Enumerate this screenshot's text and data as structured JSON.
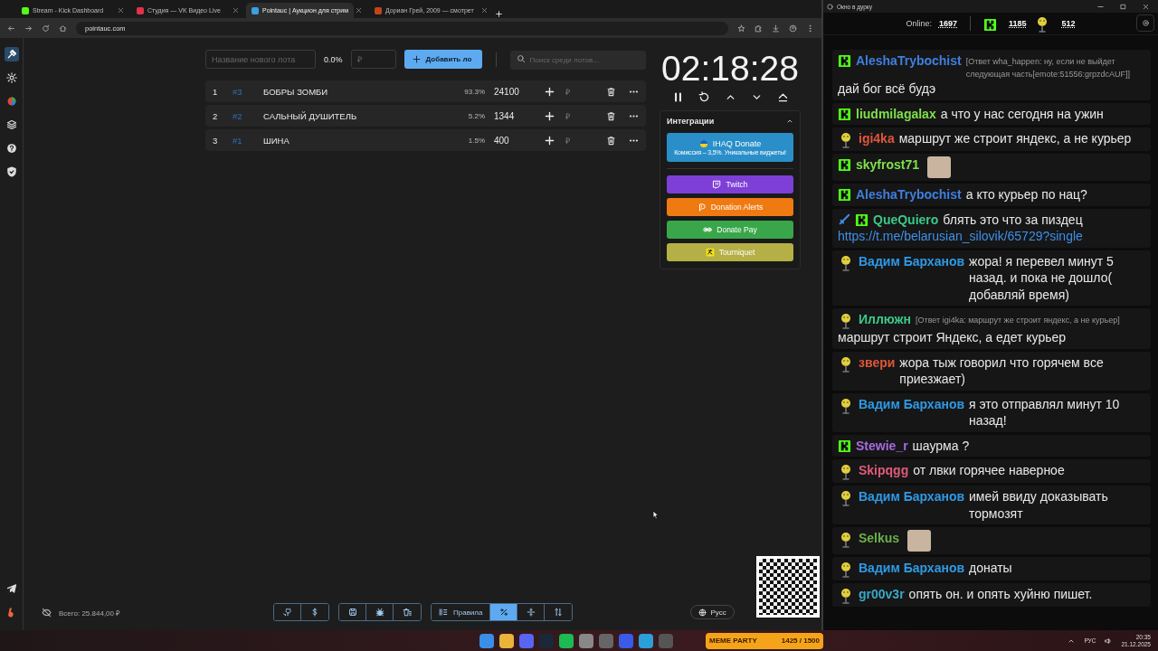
{
  "browser": {
    "tabs": [
      {
        "title": "Stream - Kick Dashboard",
        "selected": false
      },
      {
        "title": "Студия — VK Видео Live",
        "selected": false
      },
      {
        "title": "Pointauc | Аукцион для стрим",
        "selected": true
      },
      {
        "title": "Дориан Грей, 2009 — смотрет",
        "selected": false
      }
    ],
    "url": "pointauc.com"
  },
  "sidebar": {
    "items": [
      {
        "kind": "hammer",
        "selected": true
      },
      {
        "kind": "gear",
        "selected": false
      },
      {
        "kind": "wheel",
        "selected": false
      },
      {
        "kind": "layers",
        "selected": false
      },
      {
        "kind": "help",
        "selected": false
      },
      {
        "kind": "shield",
        "selected": false
      }
    ],
    "bottom_items": [
      {
        "kind": "telegram"
      },
      {
        "kind": "boosty"
      }
    ]
  },
  "auction": {
    "name_placeholder": "Название нового лота",
    "percent": "0.0%",
    "price_placeholder": "₽",
    "add_button": "Добавить ло",
    "search_placeholder": "Поиск среди лотов...",
    "lots": [
      {
        "place": "1",
        "id": "#3",
        "name": "БОБРЫ ЗОМБИ",
        "percent": "93.3%",
        "amount": "24100",
        "currency": "₽"
      },
      {
        "place": "2",
        "id": "#2",
        "name": "САЛЬНЫЙ ДУШИТЕЛЬ",
        "percent": "5.2%",
        "amount": "1344",
        "currency": "₽"
      },
      {
        "place": "3",
        "id": "#1",
        "name": "ШИНА",
        "percent": "1.5%",
        "amount": "400",
        "currency": "₽"
      }
    ]
  },
  "timer": {
    "time": "02:18:28"
  },
  "integrations": {
    "title": "Интеграции",
    "items": [
      {
        "label": "IHAQ Donate",
        "subtitle": "Комиссия – 3,5%. Уникальные виджеты!",
        "color": "#2a8fc9",
        "kind": "ihaq"
      },
      {
        "label": "Twitch",
        "color": "#7d3fd6",
        "kind": "twitch"
      },
      {
        "label": "Donation Alerts",
        "color": "#f07a12",
        "kind": "alerts"
      },
      {
        "label": "Donate Pay",
        "color": "#3aa64a",
        "kind": "pay"
      },
      {
        "label": "Tourniquet",
        "color": "#b5b045",
        "kind": "tourniquet"
      }
    ]
  },
  "footer": {
    "total": "Всего: 25.844,00 ₽",
    "groups": [
      [
        {
          "kind": "github",
          "selected": false
        },
        {
          "kind": "dollar",
          "selected": false
        }
      ],
      [
        {
          "kind": "save",
          "selected": false
        },
        {
          "kind": "bug",
          "selected": false
        },
        {
          "kind": "trash",
          "selected": false
        }
      ],
      [
        {
          "kind": "rules",
          "label": "Правила",
          "selected": false
        },
        {
          "kind": "percent",
          "selected": true
        },
        {
          "kind": "split",
          "selected": false
        },
        {
          "kind": "sort",
          "selected": false
        }
      ]
    ],
    "language": "Русс"
  },
  "chat": {
    "title": "Окно в дурку",
    "online_label": "Online:",
    "online": "1697",
    "kick_count": "1185",
    "emote_count": "512",
    "messages": [
      {
        "badges": [
          {
            "kind": "kick"
          }
        ],
        "user": "AleshaTrybochist",
        "color": "#3f7fe0",
        "reply": "[Ответ wha_happen: ну, если не выйдет следующая часть[emote:51556:grpzdcAUF]]",
        "text": "дай бог всё будэ"
      },
      {
        "badges": [
          {
            "kind": "kick"
          }
        ],
        "user": "liudmilagalax",
        "color": "#7fe04a",
        "text": "а что у нас сегодня на ужин"
      },
      {
        "badges": [
          {
            "kind": "smiley"
          }
        ],
        "user": "igi4ka",
        "color": "#e0563a",
        "text": "маршрут же строит яндекс, а не курьер"
      },
      {
        "badges": [
          {
            "kind": "kick"
          }
        ],
        "user": "skyfrost71",
        "color": "#7fe04a",
        "emote": true
      },
      {
        "badges": [
          {
            "kind": "kick"
          }
        ],
        "user": "AleshaTrybochist",
        "color": "#3f7fe0",
        "text": "а кто курьер по нац?"
      },
      {
        "badges": [
          {
            "kind": "sword"
          },
          {
            "kind": "kick"
          }
        ],
        "user": "QueQuiero",
        "color": "#3cc98a",
        "text": "блять это что за пиздец",
        "link": "https://t.me/belarusian_silovik/65729?single"
      },
      {
        "badges": [
          {
            "kind": "smiley"
          }
        ],
        "user": "Вадим Барханов",
        "color": "#2e9ae6",
        "text": "жора! я перевел минут 5 назад. и пока не дошло( добавляй время)"
      },
      {
        "badges": [
          {
            "kind": "smiley"
          }
        ],
        "user": "Иллюжн",
        "color": "#3cc98a",
        "reply": "[Ответ igi4ka: маршрут же строит яндекс, а не курьер]",
        "text": "маршрут строит Яндекс, а едет курьер"
      },
      {
        "badges": [
          {
            "kind": "smiley"
          }
        ],
        "user": "звери",
        "color": "#e0563a",
        "text": "жора тыж говорил что горячем все приезжает)"
      },
      {
        "badges": [
          {
            "kind": "smiley"
          }
        ],
        "user": "Вадим Барханов",
        "color": "#2e9ae6",
        "text": "я это отправлял минут 10 назад!"
      },
      {
        "badges": [
          {
            "kind": "kick"
          }
        ],
        "user": "Stewie_r",
        "color": "#a86ae0",
        "text": "шаурма ?"
      },
      {
        "badges": [
          {
            "kind": "smiley"
          }
        ],
        "user": "Skipqgg",
        "color": "#e05a7a",
        "text": "от лвки горячее наверное"
      },
      {
        "badges": [
          {
            "kind": "smiley"
          }
        ],
        "user": "Вадим Барханов",
        "color": "#2e9ae6",
        "text": "имей ввиду доказывать тормозят"
      },
      {
        "badges": [
          {
            "kind": "smiley"
          }
        ],
        "user": "Selkus",
        "color": "#6ab04a",
        "emote": true
      },
      {
        "badges": [
          {
            "kind": "smiley"
          }
        ],
        "user": "Вадим Барханов",
        "color": "#2e9ae6",
        "text": "донаты"
      },
      {
        "badges": [
          {
            "kind": "smiley"
          }
        ],
        "user": "gr00v3r",
        "color": "#3aa8c8",
        "text": "опять он. и опять хуйню пишет."
      }
    ]
  },
  "taskbar": {
    "widget_title": "MEME PARTY",
    "widget_count": "1425 / 1500",
    "language": "РУС",
    "time": "20:35",
    "date": "21.12.2025"
  }
}
